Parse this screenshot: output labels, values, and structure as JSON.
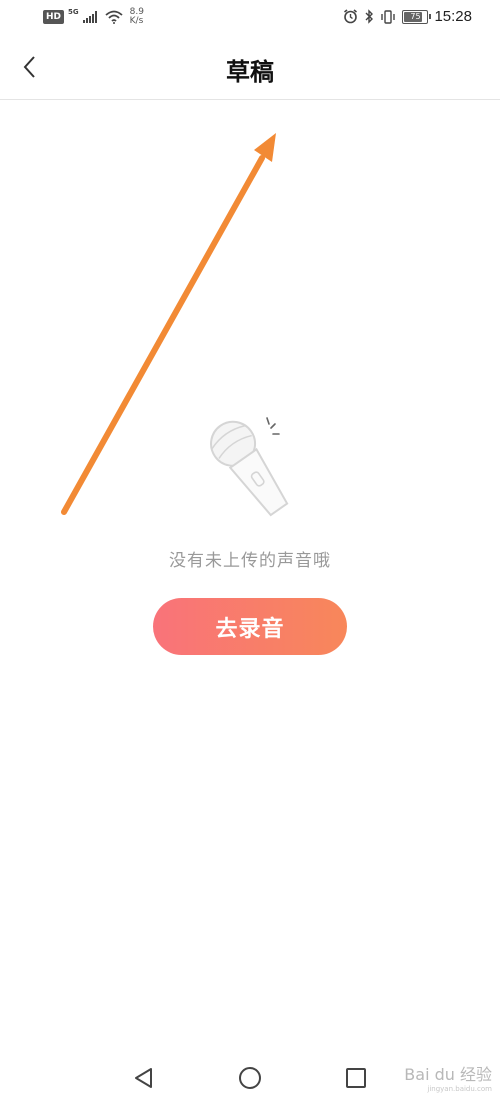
{
  "status_bar": {
    "hd": "HD",
    "network": "5G",
    "speed_value": "8.9",
    "speed_unit": "K/s",
    "battery": "75",
    "time": "15:28"
  },
  "header": {
    "title": "草稿"
  },
  "empty_state": {
    "message": "没有未上传的声音哦",
    "button_label": "去录音"
  },
  "watermark": {
    "text": "Bai du 经验",
    "sub": "jingyan.baidu.com"
  },
  "colors": {
    "arrow": "#f28a35",
    "button_start": "#f9737a",
    "button_end": "#f8875a"
  }
}
